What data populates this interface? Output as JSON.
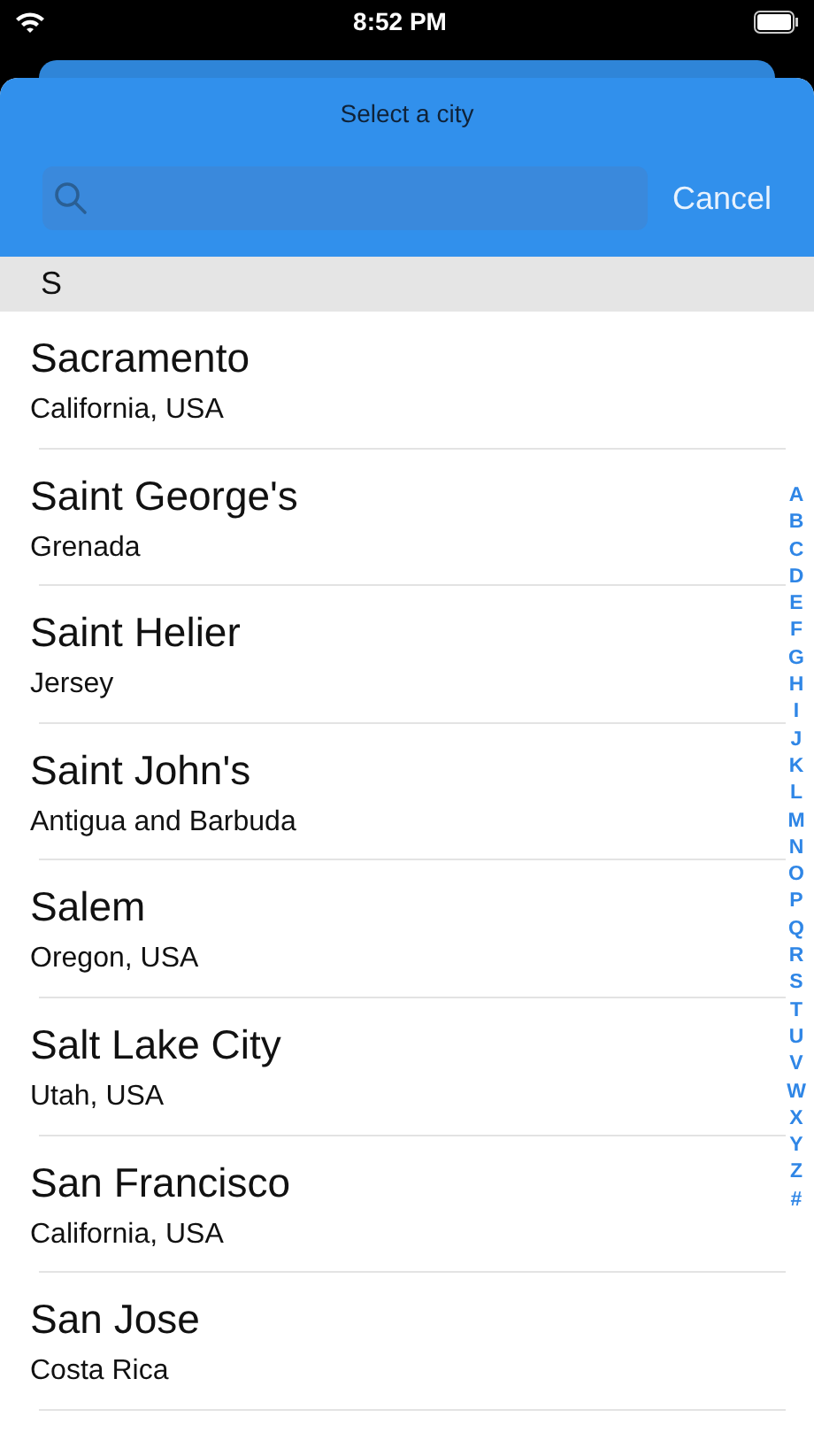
{
  "status_bar": {
    "time": "8:52 PM"
  },
  "sheet": {
    "title": "Select a city"
  },
  "search": {
    "cancel": "Cancel"
  },
  "section": {
    "header": "S"
  },
  "cities": [
    {
      "name": "Sacramento",
      "region": "California, USA"
    },
    {
      "name": "Saint George's",
      "region": "Grenada"
    },
    {
      "name": "Saint Helier",
      "region": "Jersey"
    },
    {
      "name": "Saint John's",
      "region": "Antigua and Barbuda"
    },
    {
      "name": "Salem",
      "region": "Oregon, USA"
    },
    {
      "name": "Salt Lake City",
      "region": "Utah, USA"
    },
    {
      "name": "San Francisco",
      "region": "California, USA"
    },
    {
      "name": "San Jose",
      "region": "Costa Rica"
    }
  ],
  "index": [
    "A",
    "B",
    "C",
    "D",
    "E",
    "F",
    "G",
    "H",
    "I",
    "J",
    "K",
    "L",
    "M",
    "N",
    "O",
    "P",
    "Q",
    "R",
    "S",
    "T",
    "U",
    "V",
    "W",
    "X",
    "Y",
    "Z",
    "#"
  ]
}
